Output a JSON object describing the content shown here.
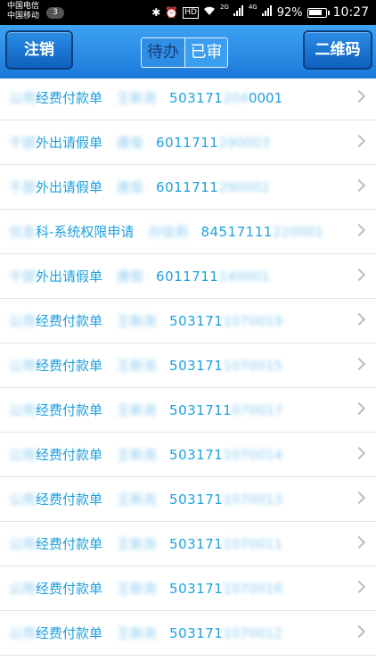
{
  "status_bar": {
    "carrier_1": "中国电信",
    "carrier_2": "中国移动",
    "sim_badge": "3",
    "network_1": "2G",
    "network_2": "4G",
    "battery": "92%",
    "battery_level": 0.92,
    "time": "10:27"
  },
  "header": {
    "logout_label": "注销",
    "tab_pending": "待办",
    "tab_approved": "已审",
    "qr_label": "二维码"
  },
  "rows": [
    {
      "title_blur": "公用",
      "title": "经费付款单",
      "person": "王新尧",
      "code_a": "503171",
      "code_blur": "204",
      "code_b": "0001"
    },
    {
      "title_blur": "干部",
      "title": "外出请假单",
      "person": "唐俊",
      "code_a": "6011711",
      "code_blur": "290003",
      "code_b": ""
    },
    {
      "title_blur": "干部",
      "title": "外出请假单",
      "person": "唐俊",
      "code_a": "6011711",
      "code_blur": "290002",
      "code_b": ""
    },
    {
      "title_blur": "信息",
      "title": "科-系统权限申请",
      "person": "孙佳莉",
      "code_a": "84517111",
      "code_blur": "220001",
      "code_b": ""
    },
    {
      "title_blur": "干部",
      "title": "外出请假单",
      "person": "唐俊",
      "code_a": "6011711",
      "code_blur": "140001",
      "code_b": ""
    },
    {
      "title_blur": "公用",
      "title": "经费付款单",
      "person": "王新尧",
      "code_a": "503171",
      "code_blur": "1070019",
      "code_b": ""
    },
    {
      "title_blur": "公用",
      "title": "经费付款单",
      "person": "王新尧",
      "code_a": "503171",
      "code_blur": "1070015",
      "code_b": ""
    },
    {
      "title_blur": "公用",
      "title": "经费付款单",
      "person": "王新尧",
      "code_a": "5031711",
      "code_blur": "070017",
      "code_b": ""
    },
    {
      "title_blur": "公用",
      "title": "经费付款单",
      "person": "王新尧",
      "code_a": "503171",
      "code_blur": "1070014",
      "code_b": ""
    },
    {
      "title_blur": "公用",
      "title": "经费付款单",
      "person": "王新尧",
      "code_a": "503171",
      "code_blur": "1070013",
      "code_b": ""
    },
    {
      "title_blur": "公用",
      "title": "经费付款单",
      "person": "王新尧",
      "code_a": "503171",
      "code_blur": "1070011",
      "code_b": ""
    },
    {
      "title_blur": "公用",
      "title": "经费付款单",
      "person": "王新尧",
      "code_a": "503171",
      "code_blur": "1070016",
      "code_b": ""
    },
    {
      "title_blur": "公用",
      "title": "经费付款单",
      "person": "王新尧",
      "code_a": "503171",
      "code_blur": "1070012",
      "code_b": ""
    }
  ],
  "colors": {
    "header_top": "#3ea3f2",
    "header_bottom": "#1a78d9",
    "list_text": "#1ea0e0"
  }
}
